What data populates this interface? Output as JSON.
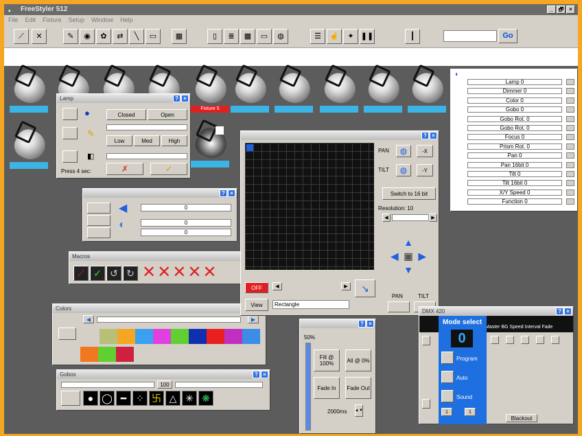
{
  "app": {
    "title": "FreeStyler 512",
    "menu": [
      "File",
      "Edit",
      "Fixture",
      "Setup",
      "Window",
      "Help"
    ],
    "go_label": "Go",
    "win_buttons": [
      "_",
      "🗗",
      "×"
    ]
  },
  "fixtures": {
    "labels": [
      "",
      "",
      "",
      "",
      "Fixture 5",
      "",
      "",
      "",
      "",
      "",
      "",
      ""
    ],
    "selected": "Fixture 5"
  },
  "lamp": {
    "title": "Lamp",
    "closed": "Closed",
    "open": "Open",
    "low": "Low",
    "med": "Med",
    "high": "High",
    "press": "Press 4 sec:"
  },
  "macros": {
    "title": "Macros"
  },
  "colors": {
    "title": "Colors",
    "palette": [
      "#b8c078",
      "#f5a623",
      "#3aa0f0",
      "#e040e0",
      "#60d030",
      "#1030b0",
      "#e82020",
      "#c030c0",
      "#3c8ce8",
      "#f07820",
      "#60d030",
      "#d02040"
    ]
  },
  "gobos": {
    "title": "Gobos",
    "glyphs": [
      "●",
      "◯",
      "━",
      "⁘",
      "卐",
      "△",
      "✳",
      "❋"
    ],
    "mid": "100"
  },
  "panel2": {
    "values": [
      "0",
      "0",
      "0"
    ]
  },
  "pantilt": {
    "pan": "PAN",
    "tilt": "TILT",
    "x": "-X",
    "y": "-Y",
    "switch": "Switch to 16 bit",
    "resolution": "Resolution: 10",
    "off": "OFF",
    "view": "View",
    "mode": "Rectangle",
    "pan_bottom": "PAN",
    "tilt_bottom": "TILT"
  },
  "dimmer": {
    "pct": "50%",
    "full": "Fill @ 100%",
    "zero": "All @ 0%",
    "fadein": "Fade In",
    "fadeout": "Fade Out",
    "time": "2000ms"
  },
  "dmx": {
    "title": "DMX 420",
    "mode_select": "Mode select",
    "value": "0",
    "opt1": "Program",
    "opt2": "Auto",
    "opt3": "Sound",
    "cols": "Master BG Speed Interval Fade",
    "blackout": "Blackout",
    "sel1": "1",
    "sel2": "1"
  },
  "channels": [
    "Lamp 0",
    "Dimmer 0",
    "Color 0",
    "Gobo 0",
    "Gobo Rot. 0",
    "Gobo Rot. 0",
    "Focus 0",
    "Prism Rot. 0",
    "Pan 0",
    "Pan 16bit 0",
    "Tilt 0",
    "Tilt 16bit 0",
    "X/Y Speed 0",
    "Function 0"
  ]
}
